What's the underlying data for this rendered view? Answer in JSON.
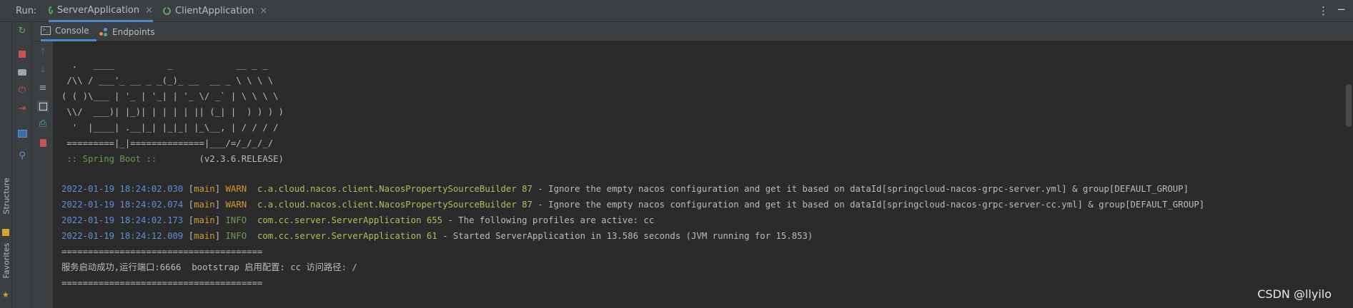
{
  "run_panel": {
    "run_label": "Run:",
    "tabs": [
      {
        "label": "ServerApplication",
        "close": "×"
      },
      {
        "label": "ClientApplication",
        "close": "×"
      }
    ],
    "kebab": "⋮",
    "minimize": "−"
  },
  "subtabs": {
    "console": "Console",
    "endpoints": "Endpoints"
  },
  "side_labels": {
    "structure": "Structure",
    "favorites": "Favorites"
  },
  "console": {
    "banner": [
      "  .   ____          _            __ _ _",
      " /\\\\ / ___'_ __ _ _(_)_ __  __ _ \\ \\ \\ \\",
      "( ( )\\___ | '_ | '_| | '_ \\/ _` | \\ \\ \\ \\",
      " \\\\/  ___)| |_)| | | | | || (_| |  ) ) ) )",
      "  '  |____| .__|_| |_|_| |_\\__, | / / / /",
      " =========|_|==============|___/=/_/_/_/"
    ],
    "spring_boot_label": " :: Spring Boot :: ",
    "spring_boot_version": "       (v2.3.6.RELEASE)",
    "logs": [
      {
        "time": "2022-01-19 18:24:02.030",
        "thread": "main",
        "level": "WARN",
        "logger": "c.a.cloud.nacos.client.NacosPropertySourceBuilder 87",
        "message": " - Ignore the empty nacos configuration and get it based on dataId[springcloud-nacos-grpc-server.yml] & group[DEFAULT_GROUP]"
      },
      {
        "time": "2022-01-19 18:24:02.074",
        "thread": "main",
        "level": "WARN",
        "logger": "c.a.cloud.nacos.client.NacosPropertySourceBuilder 87",
        "message": " - Ignore the empty nacos configuration and get it based on dataId[springcloud-nacos-grpc-server-cc.yml] & group[DEFAULT_GROUP]"
      },
      {
        "time": "2022-01-19 18:24:02.173",
        "thread": "main",
        "level": "INFO",
        "logger": "com.cc.server.ServerApplication 655",
        "message": " - The following profiles are active: cc"
      },
      {
        "time": "2022-01-19 18:24:12.009",
        "thread": "main",
        "level": "INFO",
        "logger": "com.cc.server.ServerApplication 61",
        "message": " - Started ServerApplication in 13.586 seconds (JVM running for 15.853)"
      }
    ],
    "separator1": "======================================",
    "startup_message": "服务启动成功,运行端口:6666  bootstrap 启用配置: cc 访问路径: /",
    "separator2": "======================================"
  },
  "watermark": "CSDN @llyilo",
  "colors": {
    "background": "#2b2b2b",
    "panel": "#3c3f41",
    "timestamp": "#5c8fd6",
    "warn": "#d19a2a",
    "info": "#6a9955",
    "logger": "#a5c25c",
    "accent": "#4a88c7"
  }
}
